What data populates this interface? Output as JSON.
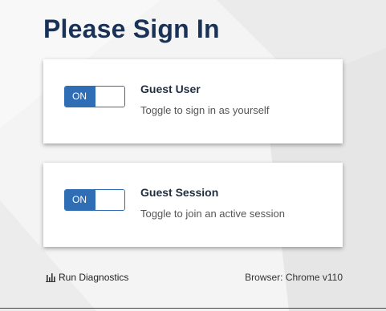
{
  "page": {
    "title": "Please Sign In"
  },
  "cards": [
    {
      "toggle_label": "ON",
      "title": "Guest User",
      "subtitle": "Toggle to sign in as yourself"
    },
    {
      "toggle_label": "ON",
      "title": "Guest Session",
      "subtitle": "Toggle to join an active session"
    }
  ],
  "footer": {
    "diagnostics_label": "Run Diagnostics",
    "diagnostics_icon": "bar-chart-icon",
    "browser_info": "Browser: Chrome v110"
  },
  "colors": {
    "title": "#1b3257",
    "toggle_on": "#2f6db5",
    "background": "#f3f3f3"
  }
}
